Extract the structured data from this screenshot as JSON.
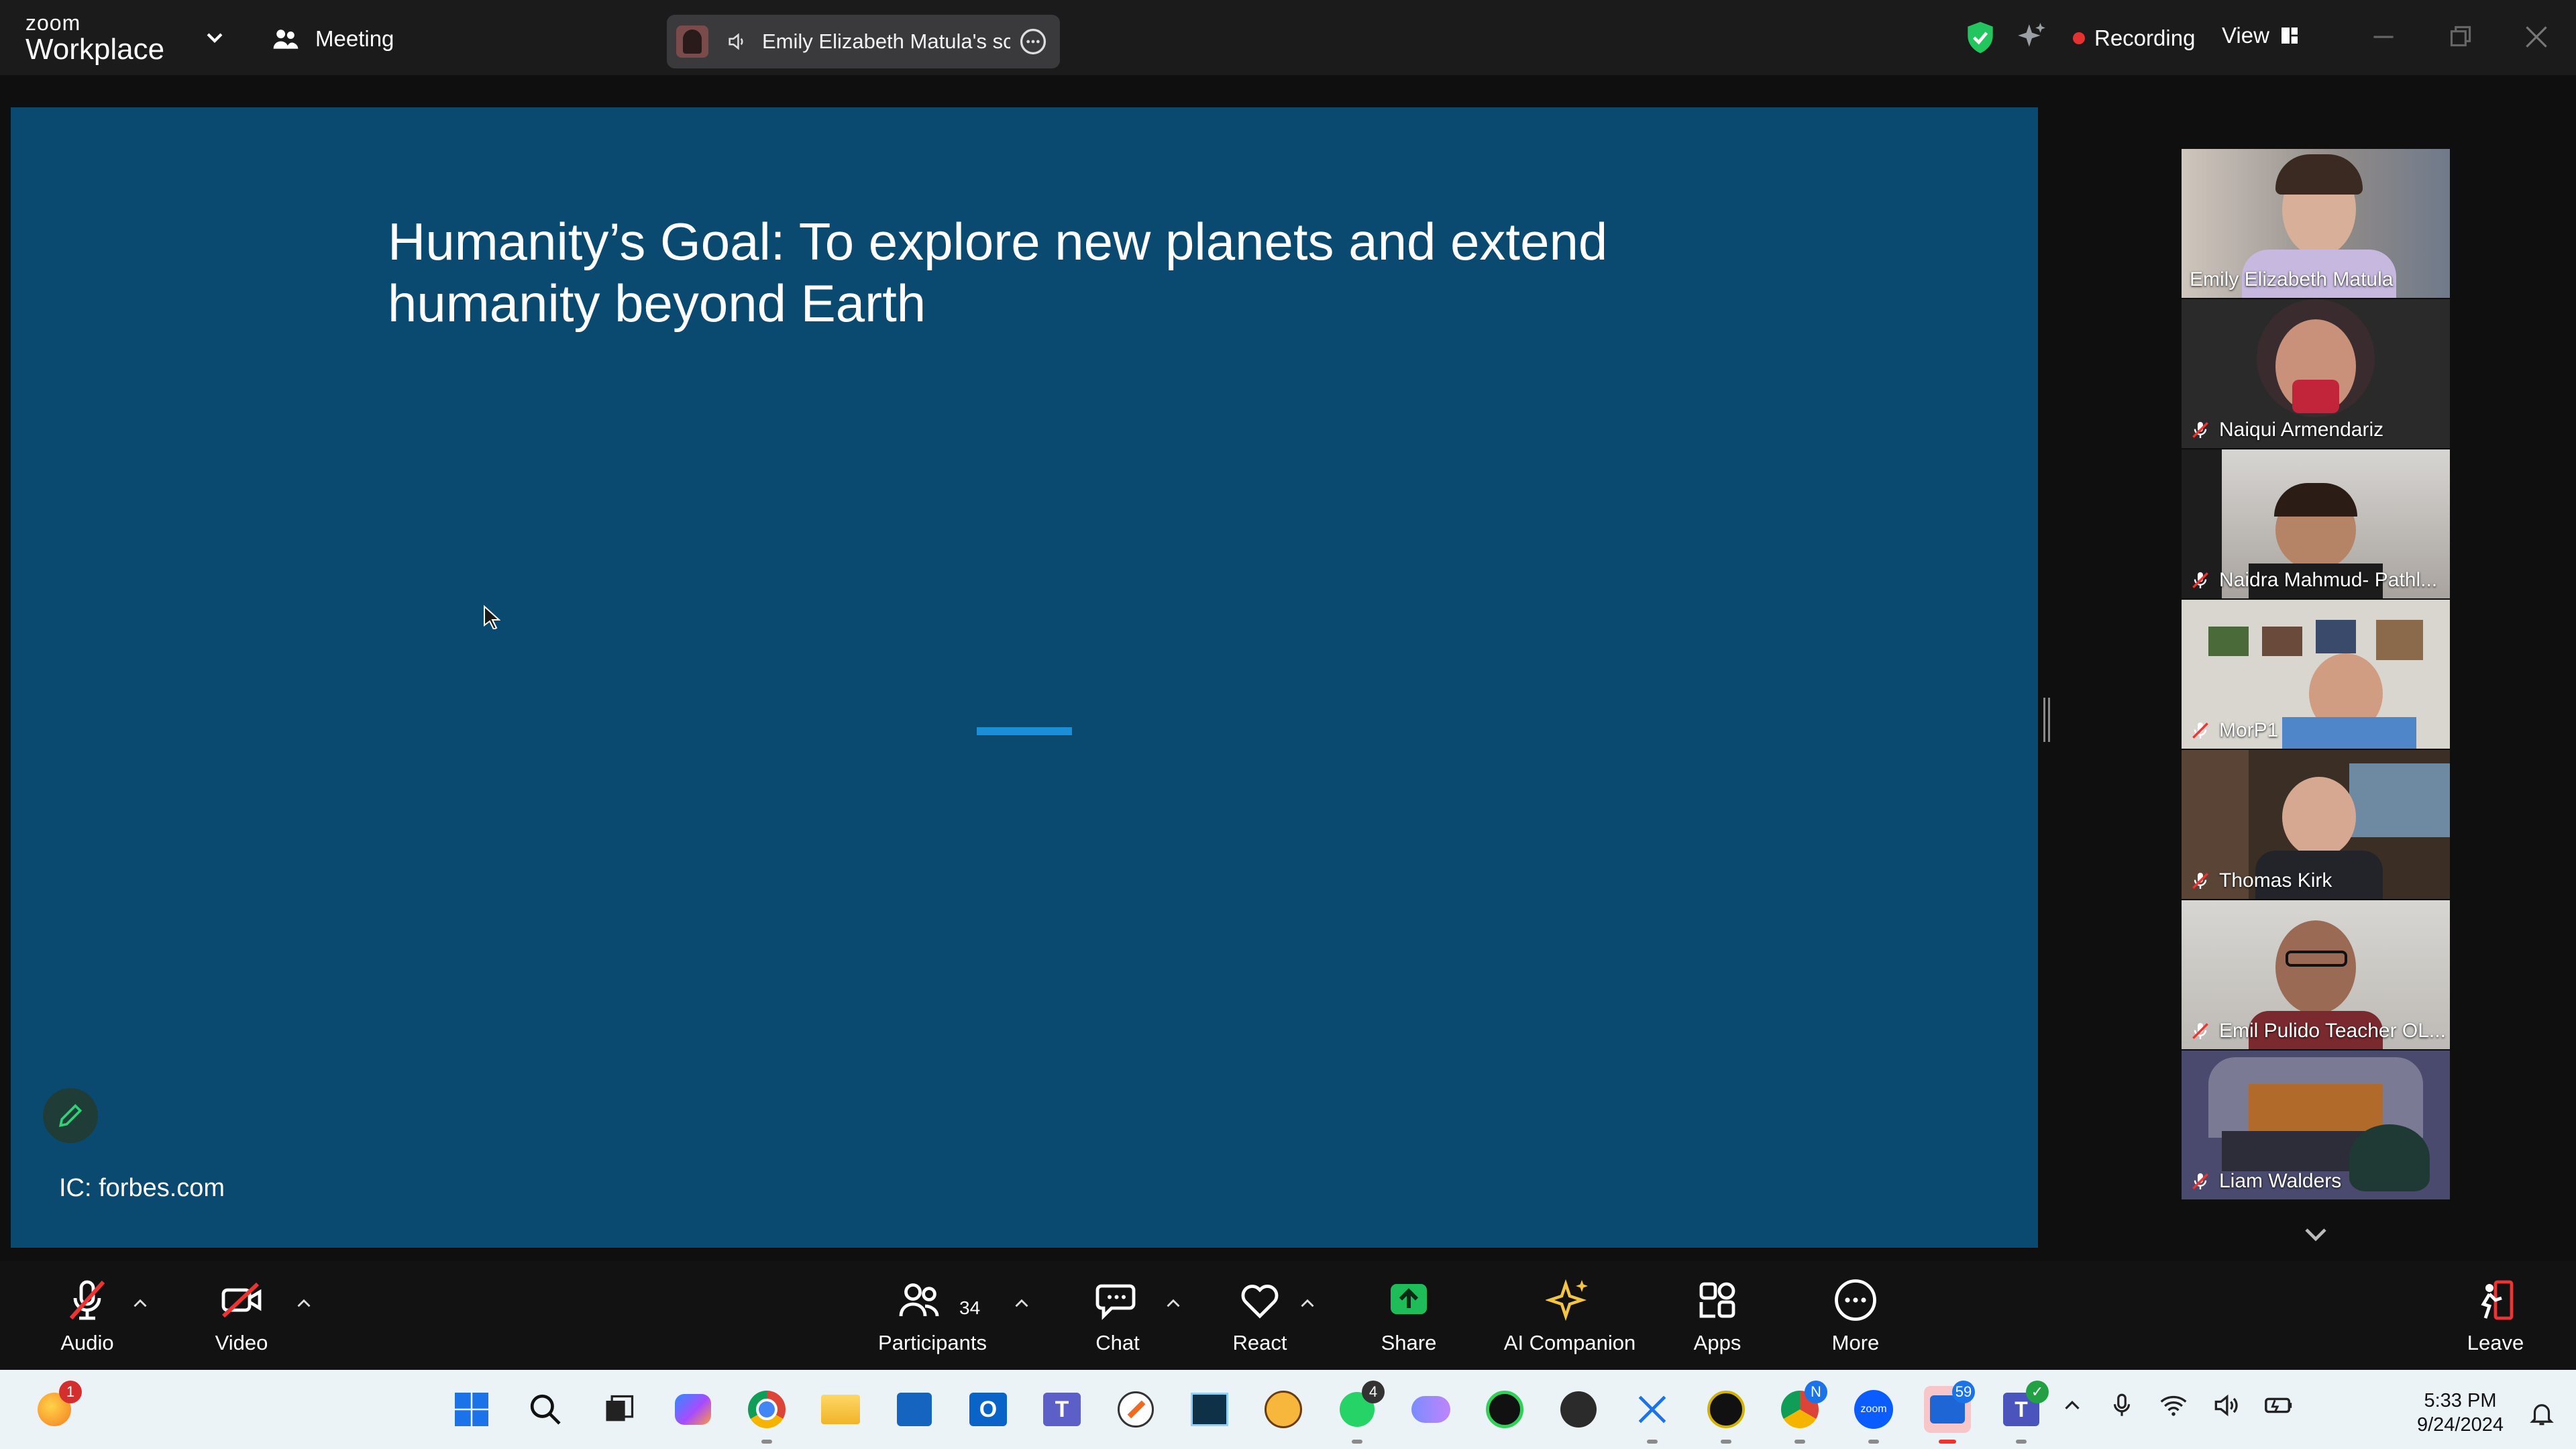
{
  "titlebar": {
    "brand_small": "zoom",
    "brand_large": "Workplace",
    "meeting_label": "Meeting",
    "share_pill_text": "Emily Elizabeth Matula's screen",
    "recording_label": "Recording",
    "view_label": "View"
  },
  "slide": {
    "title": "Humanity’s Goal: To explore new planets and extend humanity beyond Earth",
    "credit": "IC: forbes.com"
  },
  "gallery": {
    "participants": [
      {
        "name": "Emily Elizabeth Matula",
        "muted": false,
        "active": true
      },
      {
        "name": "Naiqui Armendariz",
        "muted": true
      },
      {
        "name": "Naidra Mahmud- Pathl...",
        "muted": true
      },
      {
        "name": "MorP1",
        "muted": true
      },
      {
        "name": "Thomas Kirk",
        "muted": true
      },
      {
        "name": "Emil Pulido Teacher OL...",
        "muted": true
      },
      {
        "name": "Liam Walders",
        "muted": true
      }
    ]
  },
  "toolbar": {
    "audio": "Audio",
    "video": "Video",
    "participants": "Participants",
    "participants_count": "34",
    "chat": "Chat",
    "react": "React",
    "share": "Share",
    "ai_companion": "AI Companion",
    "apps": "Apps",
    "more": "More",
    "leave": "Leave"
  },
  "taskbar": {
    "notification_badge": "1",
    "whatsapp_badge": "4",
    "chrome_badge": "N",
    "zoom_badge": "59",
    "time": "5:33 PM",
    "date": "9/24/2024"
  },
  "colors": {
    "slide_bg": "#0b4a70",
    "active_speaker": "#2fd05a",
    "share_green": "#1fbd59",
    "recording_red": "#e5312f",
    "ai_gold": "#f4c542"
  }
}
